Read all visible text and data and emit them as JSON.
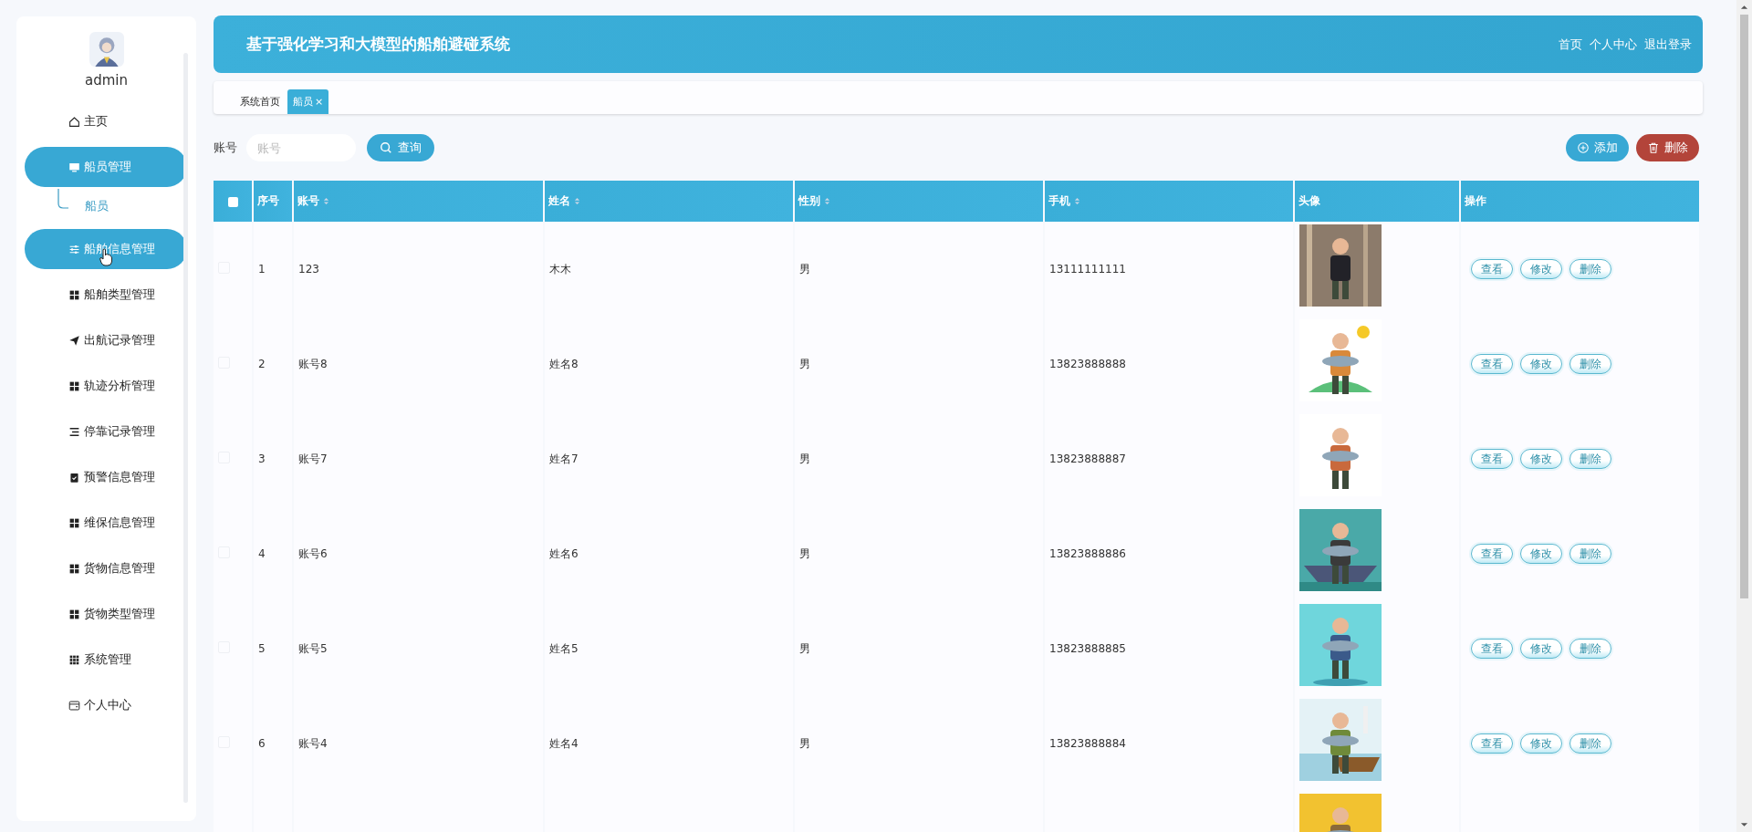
{
  "sidebar": {
    "user": {
      "avatar": {
        "kind": "picture"
      },
      "name": "admin"
    },
    "items": [
      {
        "label": "主页",
        "highlighted": false
      },
      {
        "label": "船员管理",
        "highlighted": true,
        "expanded": true,
        "children": [
          {
            "label": "船员",
            "selected": true
          }
        ]
      },
      {
        "label": "船舶信息管理",
        "highlighted": true,
        "cursor": true
      },
      {
        "label": "船舶类型管理",
        "highlighted": false
      },
      {
        "label": "出航记录管理",
        "highlighted": false
      },
      {
        "label": "轨迹分析管理",
        "highlighted": false
      },
      {
        "label": "停靠记录管理",
        "highlighted": false
      },
      {
        "label": "预警信息管理",
        "highlighted": false
      },
      {
        "label": "维保信息管理",
        "highlighted": false
      },
      {
        "label": "货物信息管理",
        "highlighted": false
      },
      {
        "label": "货物类型管理",
        "highlighted": false
      },
      {
        "label": "系统管理",
        "highlighted": false
      },
      {
        "label": "个人中心",
        "highlighted": false
      }
    ]
  },
  "header": {
    "title": "基于强化学习和大模型的船舶避碰系统",
    "links": [
      "首页",
      "个人中心",
      "退出登录"
    ]
  },
  "tabs": [
    {
      "label": "系统首页",
      "selected": false
    },
    {
      "label": "船员",
      "selected": true,
      "close": "×"
    }
  ],
  "search": {
    "label": "账号",
    "placeholder": "账号",
    "button": "查询"
  },
  "actions": [
    {
      "kind": "add",
      "label": "添加"
    },
    {
      "kind": "delete",
      "label": "删除"
    }
  ],
  "table": {
    "select_all": {
      "checked": false
    },
    "columns": [
      {
        "label": "序号",
        "sortable": false
      },
      {
        "label": "账号",
        "sortable": true
      },
      {
        "label": "姓名",
        "sortable": true
      },
      {
        "label": "性别",
        "sortable": true
      },
      {
        "label": "手机",
        "sortable": true
      },
      {
        "label": "头像",
        "sortable": false
      },
      {
        "label": "操作",
        "sortable": false
      }
    ],
    "rows": [
      {
        "checked": false,
        "no": "1",
        "account": "123",
        "name": "木木",
        "gender": "男",
        "phone": "13111111111",
        "avatar": {
          "kind": "picture"
        },
        "buttons": [
          "查看",
          "修改",
          "删除"
        ]
      },
      {
        "checked": false,
        "no": "2",
        "account": "账号8",
        "name": "姓名8",
        "gender": "男",
        "phone": "13823888888",
        "avatar": {
          "kind": "picture"
        },
        "buttons": [
          "查看",
          "修改",
          "删除"
        ]
      },
      {
        "checked": false,
        "no": "3",
        "account": "账号7",
        "name": "姓名7",
        "gender": "男",
        "phone": "13823888887",
        "avatar": {
          "kind": "picture"
        },
        "buttons": [
          "查看",
          "修改",
          "删除"
        ]
      },
      {
        "checked": false,
        "no": "4",
        "account": "账号6",
        "name": "姓名6",
        "gender": "男",
        "phone": "13823888886",
        "avatar": {
          "kind": "picture"
        },
        "buttons": [
          "查看",
          "修改",
          "删除"
        ]
      },
      {
        "checked": false,
        "no": "5",
        "account": "账号5",
        "name": "姓名5",
        "gender": "男",
        "phone": "13823888885",
        "avatar": {
          "kind": "picture"
        },
        "buttons": [
          "查看",
          "修改",
          "删除"
        ]
      },
      {
        "checked": false,
        "no": "6",
        "account": "账号4",
        "name": "姓名4",
        "gender": "男",
        "phone": "13823888884",
        "avatar": {
          "kind": "picture"
        },
        "buttons": [
          "查看",
          "修改",
          "删除"
        ]
      },
      {
        "avatar": {
          "kind": "picture"
        }
      }
    ]
  }
}
